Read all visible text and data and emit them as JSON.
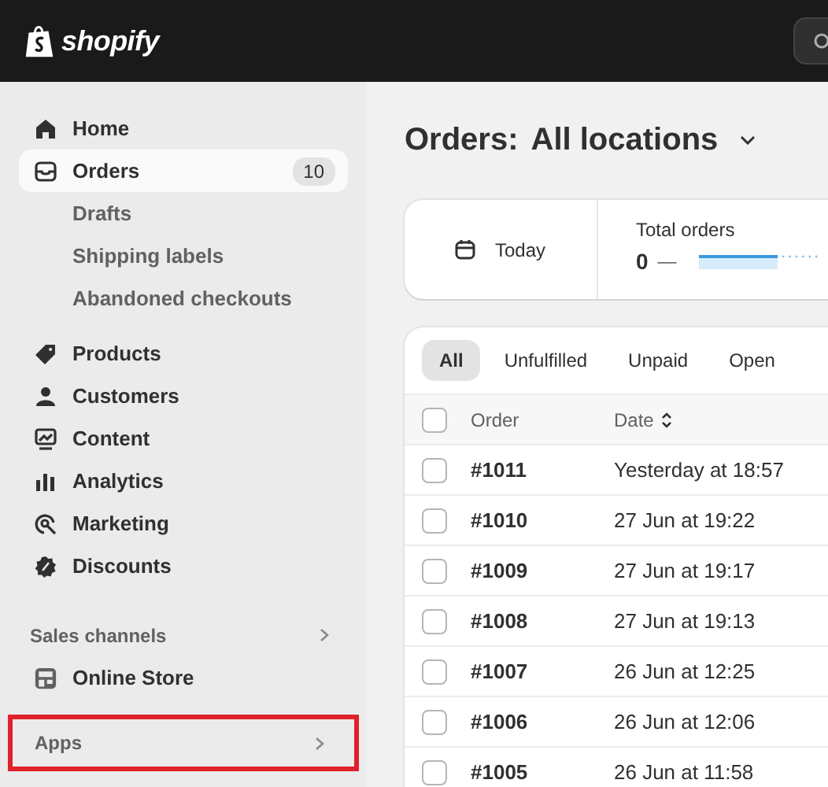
{
  "top_bar": {
    "logo_text": "shopify"
  },
  "sidebar": {
    "nav": [
      {
        "label": "Home",
        "selected": false
      },
      {
        "label": "Orders",
        "selected": true,
        "badge": "10",
        "children": [
          {
            "label": "Drafts",
            "selected": false
          },
          {
            "label": "Shipping labels",
            "selected": false
          },
          {
            "label": "Abandoned checkouts",
            "selected": false
          }
        ]
      },
      {
        "label": "Products",
        "selected": false
      },
      {
        "label": "Customers",
        "selected": false
      },
      {
        "label": "Content",
        "selected": false
      },
      {
        "label": "Analytics",
        "selected": false
      },
      {
        "label": "Marketing",
        "selected": false
      },
      {
        "label": "Discounts",
        "selected": false
      }
    ],
    "sales_channels": {
      "heading": "Sales channels",
      "items": [
        {
          "label": "Online Store",
          "selected": false
        }
      ]
    },
    "apps": {
      "label": "Apps",
      "highlighted": true
    }
  },
  "main": {
    "title": "Orders:",
    "location": "All locations",
    "date_filter": "Today",
    "metric": {
      "label": "Total orders",
      "value": "0",
      "change": "—"
    },
    "tabs": [
      {
        "label": "All",
        "selected": true
      },
      {
        "label": "Unfulfilled",
        "selected": false
      },
      {
        "label": "Unpaid",
        "selected": false
      },
      {
        "label": "Open",
        "selected": false
      }
    ],
    "table": {
      "columns": [
        "Order",
        "Date"
      ],
      "select_all_checked": false,
      "rows": [
        {
          "order": "#1011",
          "date": "Yesterday at 18:57",
          "checked": false
        },
        {
          "order": "#1010",
          "date": "27 Jun at 19:22",
          "checked": false
        },
        {
          "order": "#1009",
          "date": "27 Jun at 19:17",
          "checked": false
        },
        {
          "order": "#1008",
          "date": "27 Jun at 19:13",
          "checked": false
        },
        {
          "order": "#1007",
          "date": "26 Jun at 12:25",
          "checked": false
        },
        {
          "order": "#1006",
          "date": "26 Jun at 12:06",
          "checked": false
        },
        {
          "order": "#1005",
          "date": "26 Jun at 11:58",
          "checked": false
        }
      ]
    }
  }
}
